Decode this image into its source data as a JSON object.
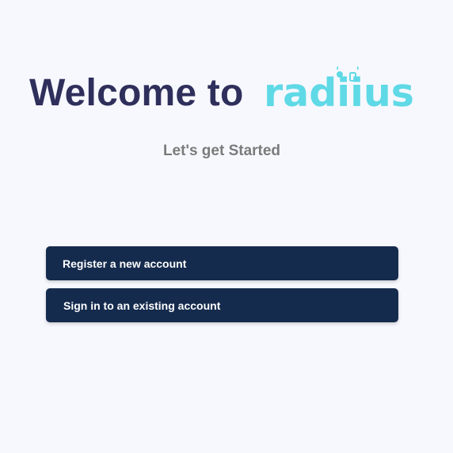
{
  "header": {
    "welcome_text": "Welcome to",
    "logo_text": "radiius",
    "logo_icon": "person-with-phone-icon"
  },
  "subtitle": "Let's get Started",
  "actions": {
    "register_label": "Register a new account",
    "signin_label": "Sign in to an existing account"
  },
  "colors": {
    "background": "#f7f8fe",
    "welcome_text": "#2f2f5c",
    "logo": "#5fd9e6",
    "subtitle": "#7b7b7b",
    "button_bg": "#152b4d",
    "button_text": "#ffffff"
  }
}
